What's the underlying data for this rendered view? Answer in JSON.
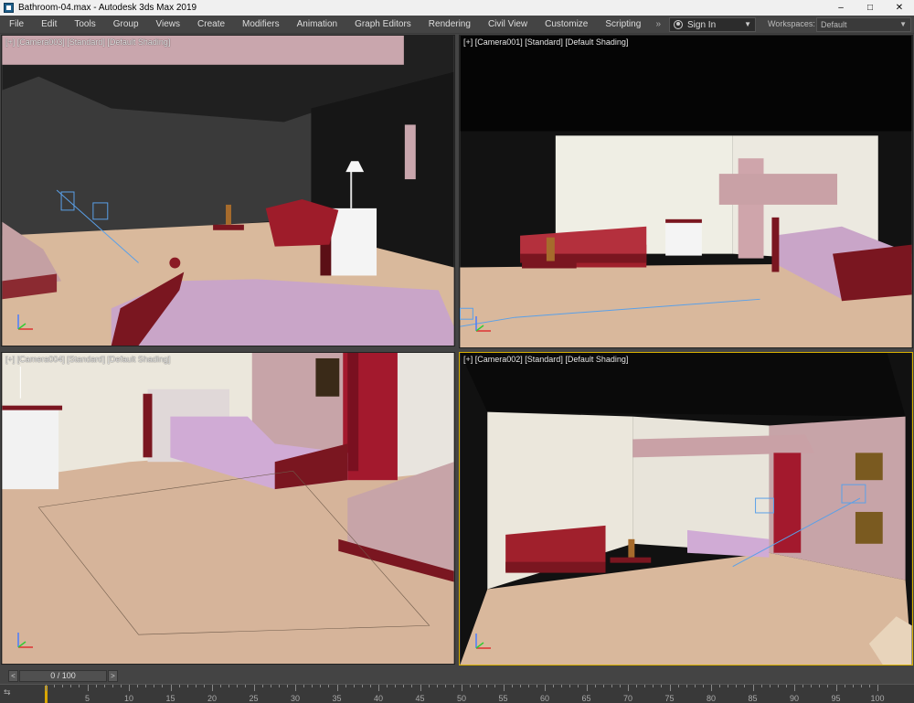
{
  "window": {
    "title": "Bathroom-04.max - Autodesk 3ds Max 2019",
    "controls": {
      "minimize": "–",
      "maximize": "□",
      "close": "✕"
    }
  },
  "menu": {
    "items": [
      "File",
      "Edit",
      "Tools",
      "Group",
      "Views",
      "Create",
      "Modifiers",
      "Animation",
      "Graph Editors",
      "Rendering",
      "Civil View",
      "Customize",
      "Scripting"
    ],
    "expand": "»",
    "signin": "Sign In",
    "workspaces_label": "Workspaces:",
    "workspace_value": "Default"
  },
  "viewports": [
    {
      "label": "[+] [Camera003] [Standard] [Default Shading]"
    },
    {
      "label": "[+] [Camera001] [Standard] [Default Shading]"
    },
    {
      "label": "[+] [Camera004] [Standard] [Default Shading]"
    },
    {
      "label": "[+] [Camera002] [Standard] [Default Shading]"
    }
  ],
  "timeline": {
    "position": "0 / 100",
    "prev": "<",
    "next": ">",
    "ruler_numbers": [
      "5",
      "10",
      "15",
      "20",
      "25",
      "30",
      "35",
      "40",
      "45",
      "50",
      "55",
      "60",
      "65",
      "70",
      "75",
      "80",
      "85",
      "90",
      "95",
      "100"
    ],
    "current_frame": 0,
    "total_frames": 100
  },
  "colors": {
    "accent": "#d8b000",
    "ui_background": "#444444",
    "floor": "#d8b89a",
    "wall_pink": "#c7a4a8",
    "furniture_red": "#8b1a24"
  }
}
